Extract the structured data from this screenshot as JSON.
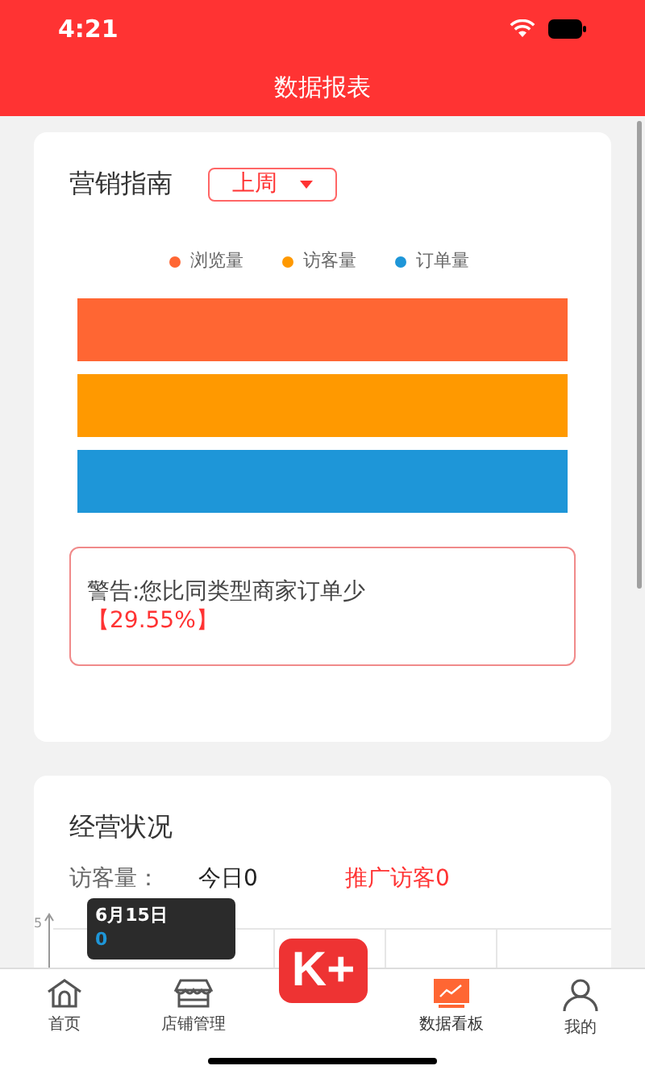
{
  "status_bar": {
    "time": "4:21"
  },
  "header": {
    "title": "数据报表"
  },
  "marketing_card": {
    "title": "营销指南",
    "period_dropdown": {
      "value": "上周"
    },
    "legend": [
      {
        "label": "浏览量",
        "color": "#ff6633"
      },
      {
        "label": "访客量",
        "color": "#ff9900"
      },
      {
        "label": "订单量",
        "color": "#1e96d8"
      }
    ],
    "warning": {
      "text": "警告:您比同类型商家订单少",
      "value": "【29.55%】"
    }
  },
  "business_card": {
    "title": "经营状况",
    "visitor_label": "访客量：",
    "today": "今日0",
    "promoted": "推广访客0",
    "chart": {
      "y_tick": "5",
      "tooltip": {
        "date": "6月15日",
        "value": "0"
      }
    }
  },
  "center_logo": {
    "text": "K+"
  },
  "tab_bar": [
    {
      "label": "首页",
      "selected": false
    },
    {
      "label": "店铺管理",
      "selected": false
    },
    {
      "label": "数据看板",
      "selected": true
    },
    {
      "label": "我的",
      "selected": false
    }
  ]
}
